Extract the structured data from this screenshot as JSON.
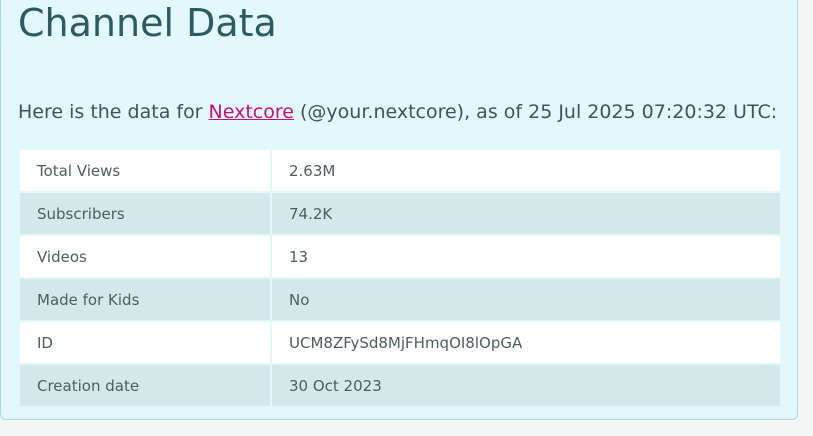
{
  "page": {
    "title": "Channel Data",
    "intro_prefix": "Here is the data for ",
    "channel_name": "Nextcore",
    "intro_suffix": " (@your.nextcore), as of 25 Jul 2025 07:20:32 UTC:"
  },
  "stats": [
    {
      "label": "Total Views",
      "value": "2.63M"
    },
    {
      "label": "Subscribers",
      "value": "74.2K"
    },
    {
      "label": "Videos",
      "value": "13"
    },
    {
      "label": "Made for Kids",
      "value": "No"
    },
    {
      "label": "ID",
      "value": "UCM8ZFySd8MjFHmqOI8lOpGA"
    },
    {
      "label": "Creation date",
      "value": "30 Oct 2023"
    }
  ]
}
